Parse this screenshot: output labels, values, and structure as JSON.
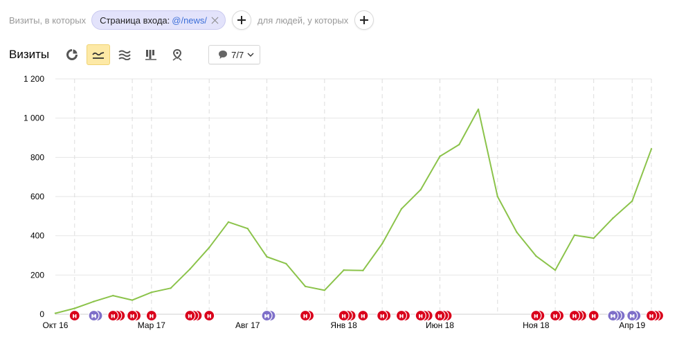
{
  "filter": {
    "prefix": "Визиты, в которых",
    "chip_label": "Страница входа:",
    "chip_value": "@/news/",
    "middle": "для людей, у которых"
  },
  "toolbar": {
    "title": "Визиты",
    "tools": [
      "pie-chart-icon",
      "line-chart-icon",
      "stacked-area-icon",
      "bar-chart-icon",
      "map-pin-icon"
    ],
    "active_tool": "line-chart-icon",
    "annotations_filter": "7/7"
  },
  "colors": {
    "line": "#8bc34a",
    "marker_red": "#d9001b",
    "marker_purple": "#7e6fc9",
    "chip_bg": "#e3e3fb",
    "chip_value": "#3c6fd8",
    "active_tool": "#fde9a6"
  },
  "chart_data": {
    "type": "line",
    "ylim": [
      0,
      1200
    ],
    "yticks": [
      "0",
      "200",
      "400",
      "600",
      "800",
      "1 000",
      "1 200"
    ],
    "ytick_values": [
      0,
      200,
      400,
      600,
      800,
      1000,
      1200
    ],
    "x": [
      "2016-10",
      "2016-11",
      "2016-12",
      "2017-01",
      "2017-02",
      "2017-03",
      "2017-04",
      "2017-05",
      "2017-06",
      "2017-07",
      "2017-08",
      "2017-09",
      "2017-10",
      "2017-11",
      "2017-12",
      "2018-01",
      "2018-02",
      "2018-03",
      "2018-04",
      "2018-05",
      "2018-06",
      "2018-07",
      "2018-08",
      "2018-09",
      "2018-10",
      "2018-11",
      "2018-12",
      "2019-01",
      "2019-02",
      "2019-03",
      "2019-04",
      "2019-05"
    ],
    "xtick_labels": [
      {
        "index": 0,
        "label": "Окт 16"
      },
      {
        "index": 5,
        "label": "Мар 17"
      },
      {
        "index": 10,
        "label": "Авг 17"
      },
      {
        "index": 15,
        "label": "Янв 18"
      },
      {
        "index": 20,
        "label": "Июн 18"
      },
      {
        "index": 25,
        "label": "Ноя 18"
      },
      {
        "index": 30,
        "label": "Апр 19"
      }
    ],
    "vertical_gridlines": [
      "2016-11",
      "2017-02",
      "2017-03",
      "2017-06",
      "2017-09",
      "2017-12",
      "2018-03",
      "2018-06",
      "2018-09",
      "2018-12",
      "2019-02",
      "2019-04",
      "2019-05"
    ],
    "series": [
      {
        "values": [
          5,
          30,
          65,
          95,
          72,
          112,
          133,
          230,
          340,
          470,
          437,
          293,
          258,
          142,
          122,
          225,
          223,
          360,
          537,
          635,
          805,
          865,
          1045,
          600,
          418,
          297,
          225,
          403,
          388,
          490,
          577,
          843
        ]
      }
    ],
    "annotations": [
      {
        "x": 1,
        "glyphs": [
          "н"
        ],
        "color": "red"
      },
      {
        "x": 2,
        "glyphs": [
          "м",
          "м"
        ],
        "color": "purple"
      },
      {
        "x": 3,
        "glyphs": [
          "н",
          "н",
          "н"
        ],
        "color": "red"
      },
      {
        "x": 4,
        "glyphs": [
          "н",
          "н"
        ],
        "color": "red"
      },
      {
        "x": 5,
        "glyphs": [
          "н"
        ],
        "color": "red"
      },
      {
        "x": 7,
        "glyphs": [
          "н",
          "н",
          "н"
        ],
        "color": "red"
      },
      {
        "x": 8,
        "glyphs": [
          "н"
        ],
        "color": "red"
      },
      {
        "x": 11,
        "glyphs": [
          "м",
          "м"
        ],
        "color": "purple"
      },
      {
        "x": 13,
        "glyphs": [
          "н",
          "н"
        ],
        "color": "red"
      },
      {
        "x": 15,
        "glyphs": [
          "н",
          "н",
          "н"
        ],
        "color": "red"
      },
      {
        "x": 16,
        "glyphs": [
          "н"
        ],
        "color": "red"
      },
      {
        "x": 17,
        "glyphs": [
          "н",
          "н"
        ],
        "color": "red"
      },
      {
        "x": 18,
        "glyphs": [
          "н",
          "н"
        ],
        "color": "red"
      },
      {
        "x": 19,
        "glyphs": [
          "н",
          "н",
          "н"
        ],
        "color": "red"
      },
      {
        "x": 20,
        "glyphs": [
          "н",
          "н",
          "н"
        ],
        "color": "red"
      },
      {
        "x": 25,
        "glyphs": [
          "н",
          "н"
        ],
        "color": "red"
      },
      {
        "x": 26,
        "glyphs": [
          "н",
          "н"
        ],
        "color": "red"
      },
      {
        "x": 27,
        "glyphs": [
          "н",
          "н",
          "н"
        ],
        "color": "red"
      },
      {
        "x": 28,
        "glyphs": [
          "н"
        ],
        "color": "red"
      },
      {
        "x": 29,
        "glyphs": [
          "м",
          "м",
          "м"
        ],
        "color": "purple"
      },
      {
        "x": 30,
        "glyphs": [
          "м",
          "м"
        ],
        "color": "purple"
      },
      {
        "x": 31,
        "glyphs": [
          "н",
          "н",
          "н"
        ],
        "color": "red"
      }
    ]
  }
}
